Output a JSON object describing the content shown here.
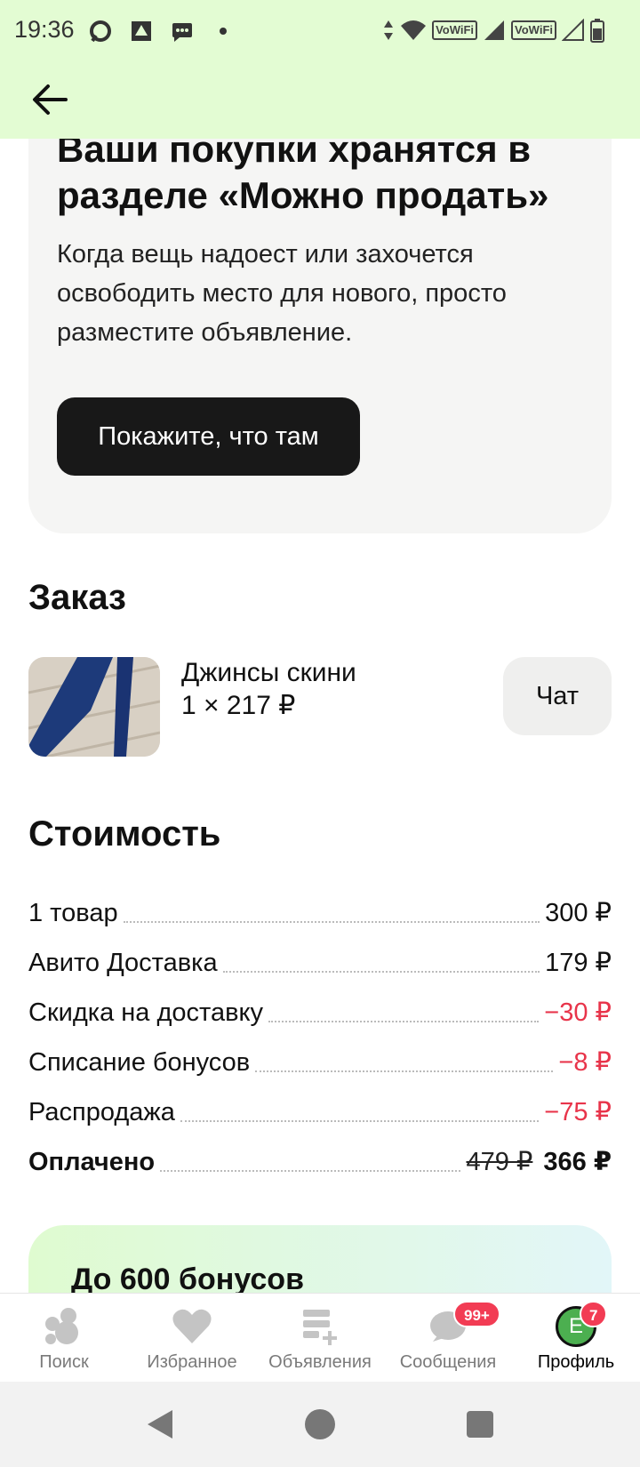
{
  "status_bar": {
    "time": "19:36",
    "vowifi_1": "VoWiFi",
    "vowifi_2": "VoWiFi"
  },
  "promo": {
    "title": "Ваши покупки хранятся в разделе «Можно продать»",
    "text": "Когда вещь надоест или захочется освободить место для нового, просто разместите объявление.",
    "button_label": "Покажите, что там"
  },
  "order": {
    "title": "Заказ",
    "item_name": "Джинсы скини",
    "item_qty_price": "1 × 217 ₽",
    "chat_label": "Чат"
  },
  "cost": {
    "title": "Стоимость",
    "rows": [
      {
        "label": "1 товар",
        "value": "300 ₽"
      },
      {
        "label": "Авито Доставка",
        "value": "179 ₽"
      },
      {
        "label": "Скидка на доставку",
        "value": "−30 ₽"
      },
      {
        "label": "Списание бонусов",
        "value": "−8 ₽"
      },
      {
        "label": "Распродажа",
        "value": "−75 ₽"
      }
    ],
    "total": {
      "label": "Оплачено",
      "old_value": "479 ₽",
      "value": "366 ₽"
    }
  },
  "bonus": {
    "title": "До 600 бонусов"
  },
  "bottom_nav": {
    "items": [
      {
        "label": "Поиск"
      },
      {
        "label": "Избранное"
      },
      {
        "label": "Объявления"
      },
      {
        "label": "Сообщения",
        "badge": "99+"
      },
      {
        "label": "Профиль",
        "badge": "7",
        "avatar_letter": "Е"
      }
    ]
  },
  "colors": {
    "topbar_bg": "#e3fcd3",
    "negative": "#e8344a",
    "badge": "#f23c54",
    "primary_button": "#181818"
  }
}
